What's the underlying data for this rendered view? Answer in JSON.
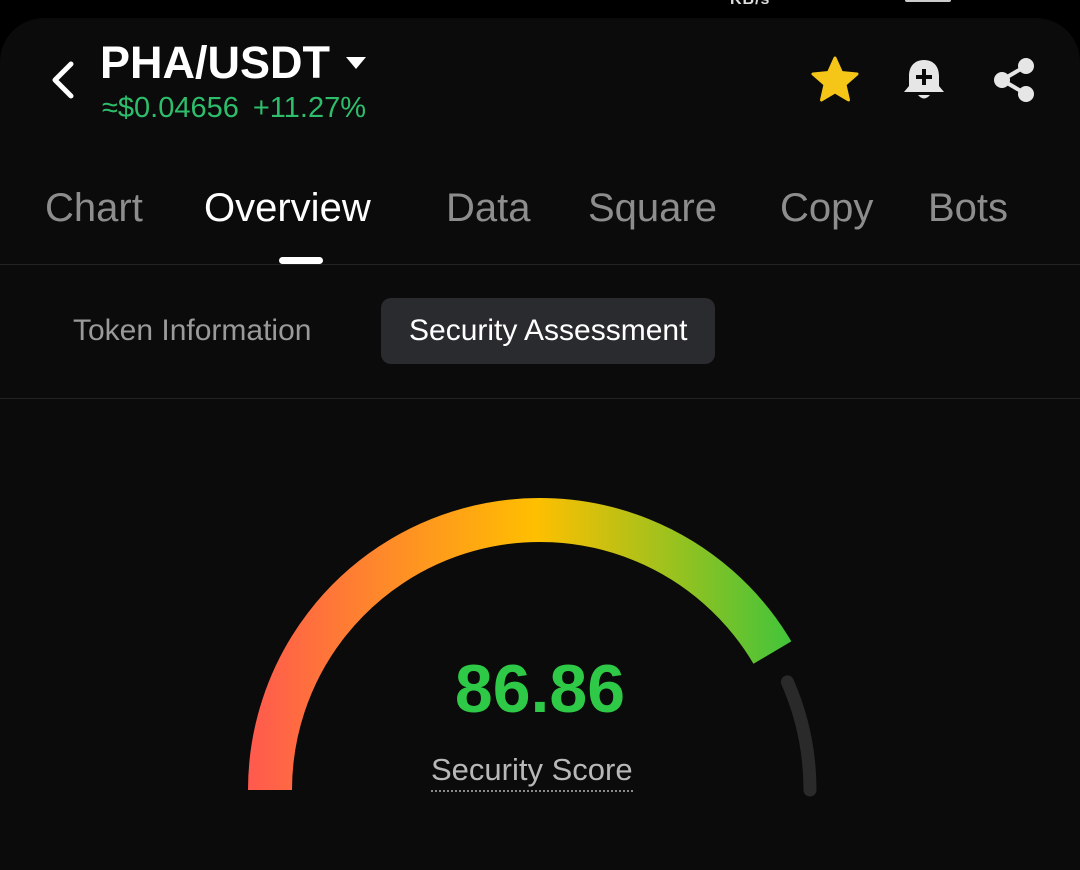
{
  "status": {
    "partial_text": "KB/s"
  },
  "header": {
    "pair": "PHA/USDT",
    "price": "≈$0.04656",
    "change": "+11.27%",
    "icons": [
      "back-arrow-icon",
      "dropdown-caret-icon",
      "star-icon",
      "bell-add-icon",
      "share-icon"
    ]
  },
  "tabs": [
    {
      "label": "Chart"
    },
    {
      "label": "Overview"
    },
    {
      "label": "Data"
    },
    {
      "label": "Square"
    },
    {
      "label": "Copy"
    },
    {
      "label": "Bots"
    }
  ],
  "active_tab": "Overview",
  "subtabs": [
    {
      "label": "Token Information"
    },
    {
      "label": "Security Assessment"
    }
  ],
  "active_subtab": "Security Assessment",
  "security": {
    "score": "86.86",
    "score_value": 86.86,
    "score_max": 100,
    "label": "Security Score"
  },
  "colors": {
    "accent_green": "#2ebd6b",
    "score_green": "#2ec946",
    "star_yellow": "#f5c518",
    "gauge_low": "#ff5a4e",
    "gauge_mid": "#ffbf00",
    "gauge_high": "#3cc43c",
    "gauge_track": "#2a2a2a"
  }
}
